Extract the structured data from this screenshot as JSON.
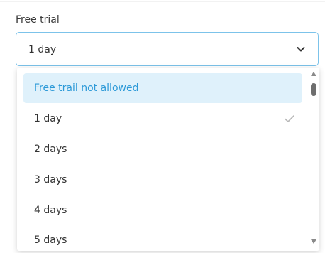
{
  "field": {
    "label": "Free trial",
    "selected_value": "1 day"
  },
  "dropdown": {
    "options": [
      {
        "label": "Free trail not allowed",
        "highlighted": true,
        "selected": false
      },
      {
        "label": "1 day",
        "highlighted": false,
        "selected": true
      },
      {
        "label": "2 days",
        "highlighted": false,
        "selected": false
      },
      {
        "label": "3 days",
        "highlighted": false,
        "selected": false
      },
      {
        "label": "4 days",
        "highlighted": false,
        "selected": false
      },
      {
        "label": "5 days",
        "highlighted": false,
        "selected": false
      }
    ]
  },
  "icons": {
    "chevron": "chevron-down-icon",
    "check": "check-icon"
  },
  "colors": {
    "accent": "#2d9ad8",
    "highlight_bg": "#dff1fb",
    "focus_border": "#7cc3ea"
  }
}
